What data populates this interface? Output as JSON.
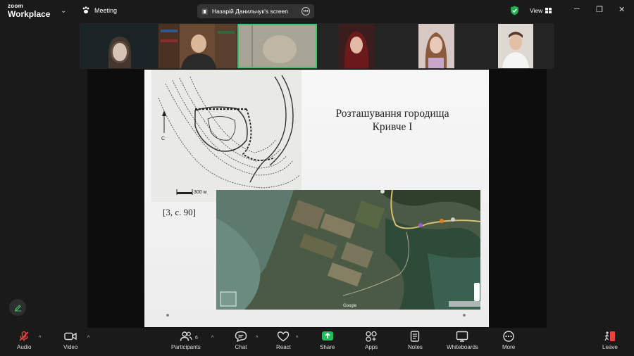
{
  "app": {
    "logo_line1": "zoom",
    "logo_line2": "Workplace",
    "meeting_label": "Meeting"
  },
  "share": {
    "label": "Назарій Данильчук's screen",
    "more_icon": "ellipsis-icon"
  },
  "header": {
    "view_label": "View",
    "security_color": "#22b14c"
  },
  "slide": {
    "title_line1": "Розташування городища",
    "title_line2": "Кривче I",
    "citation": "[3, с. 90]",
    "scale_label": "300 м",
    "satellite_brand": "Google"
  },
  "toolbar": {
    "audio": "Audio",
    "video": "Video",
    "participants": "Participants",
    "participants_count": "6",
    "chat": "Chat",
    "react": "React",
    "share": "Share",
    "apps": "Apps",
    "notes": "Notes",
    "whiteboards": "Whiteboards",
    "more": "More",
    "leave": "Leave"
  },
  "colors": {
    "share_green": "#1fbe5c",
    "active_speaker": "#3ec46d",
    "leave_red": "#e8443a",
    "mute_red": "#e8443a"
  }
}
